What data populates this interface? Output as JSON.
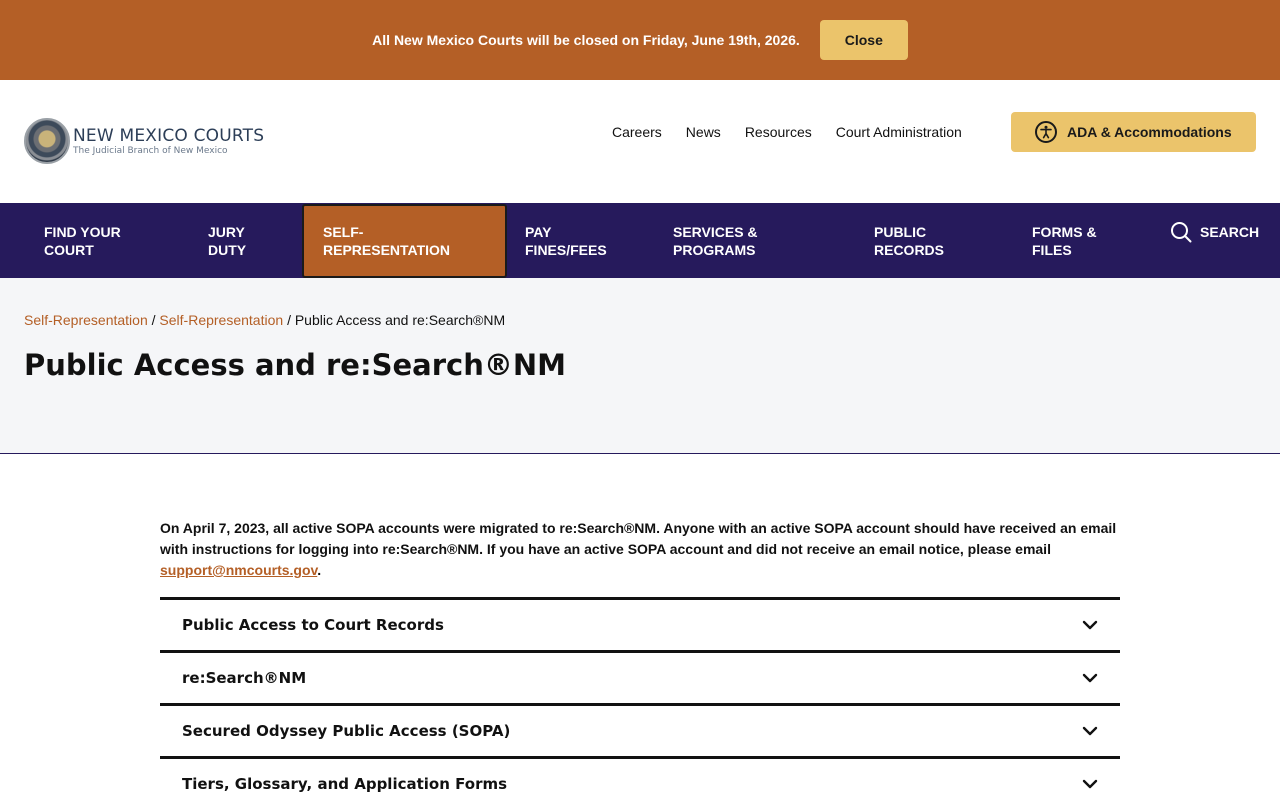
{
  "alert": {
    "message": "All New Mexico Courts will be closed on Friday, June 19th, 2026.",
    "close_label": "Close"
  },
  "header": {
    "logo_title": "NEW MEXICO COURTS",
    "logo_subtitle": "The Judicial Branch of New Mexico",
    "utility_links": [
      "Careers",
      "News",
      "Resources",
      "Court Administration"
    ],
    "ada_label": "ADA & Accommodations"
  },
  "nav": {
    "items": [
      "FIND YOUR\nCOURT",
      "JURY\nDUTY",
      "SELF-\nREPRESENTATION",
      "PAY\nFINES/FEES",
      "SERVICES &\nPROGRAMS",
      "PUBLIC\nRECORDS",
      "FORMS &\nFILES"
    ],
    "active_index": 2,
    "search_label": "SEARCH"
  },
  "breadcrumb": {
    "items": [
      "Self-Representation",
      "Self-Representation"
    ],
    "separator": "/",
    "current": "Public Access and re:Search®NM"
  },
  "page": {
    "title": "Public Access and re:Search®NM",
    "intro": "On April 7, 2023, all active SOPA accounts were migrated to re:Search®NM. Anyone with an active SOPA account should have received an email with instructions for logging into re:Search®NM. If you have an active SOPA account and did not receive an email notice, please email",
    "intro_email": "support@nmcourts.gov",
    "intro_end": "."
  },
  "accordion": {
    "items": [
      "Public Access to Court Records",
      "re:Search®NM",
      "Secured Odyssey Public Access (SOPA)",
      "Tiers, Glossary, and Application Forms"
    ]
  },
  "colors": {
    "brand_orange": "#b45f26",
    "brand_gold": "#ebc46b",
    "nav_navy": "#261a5c"
  }
}
